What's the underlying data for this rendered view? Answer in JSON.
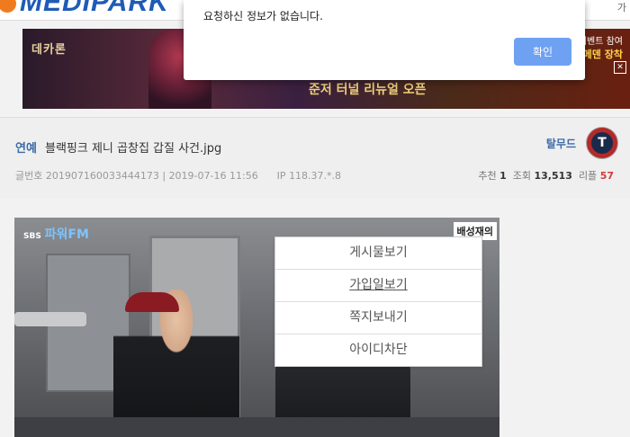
{
  "site": {
    "logo": "MEDIPARK",
    "top_right": "가"
  },
  "ad": {
    "game_logo": "데카론",
    "caption": "준저 터널 리뉴얼 오픈",
    "event_line1": "이벤트 참여",
    "event_line2": "아크메덴 장착"
  },
  "post": {
    "category": "연예",
    "title": "블랙핑크 제니 곱창집 갑질 사건.jpg",
    "author": "탈무드",
    "post_no_label": "글번호",
    "post_no": "201907160033444173",
    "datetime": "2019-07-16 11:56",
    "ip_label": "IP",
    "ip": "118.37.*.8",
    "recommend_label": "추천",
    "recommend": "1",
    "views_label": "조회",
    "views": "13,513",
    "replies_label": "리플",
    "replies": "57"
  },
  "photo": {
    "station": "SBS",
    "channel": "파워FM",
    "nameplate": "배성재의"
  },
  "context_menu": {
    "items": [
      "게시물보기",
      "가입일보기",
      "쪽지보내기",
      "아이디차단"
    ]
  },
  "dialog": {
    "message": "요청하신 정보가 없습니다.",
    "ok_label": "확인"
  }
}
